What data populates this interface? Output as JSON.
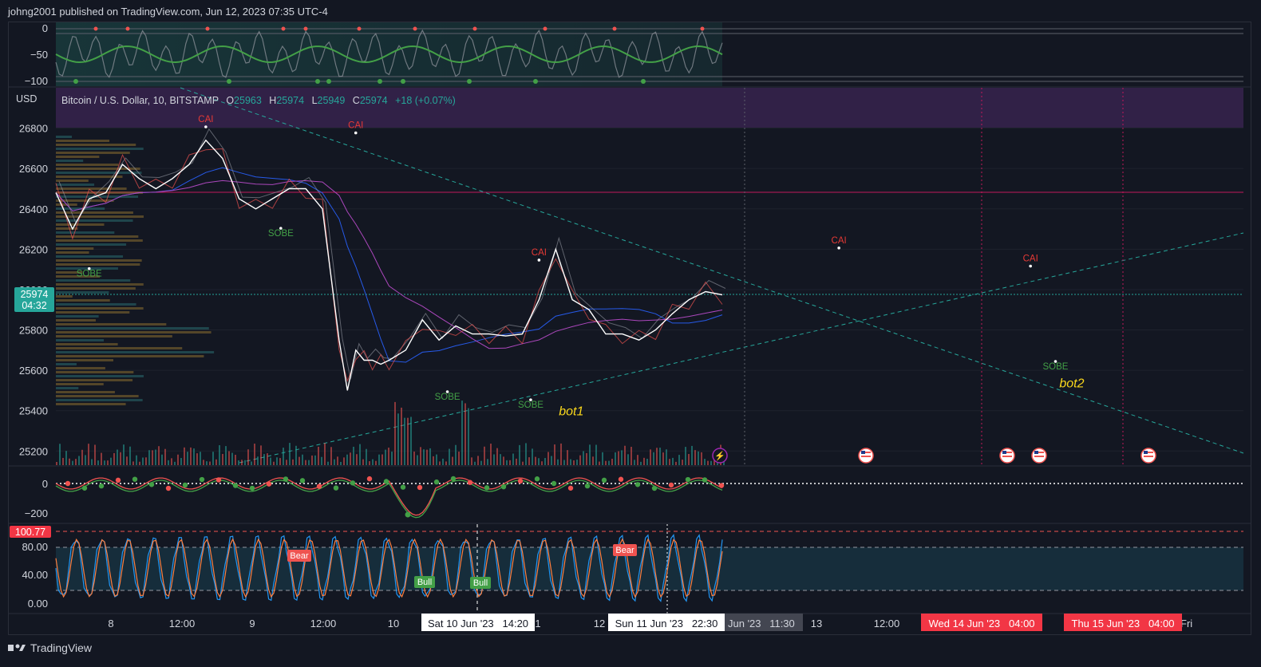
{
  "publisher": "johng2001 published on TradingView.com, Jun 12, 2023 07:35 UTC-4",
  "footer_brand": "TradingView",
  "symbol_line": {
    "name": "Bitcoin / U.S. Dollar, 10, BITSTAMP",
    "o_label": "O",
    "o": "25963",
    "h_label": "H",
    "h": "25974",
    "l_label": "L",
    "l": "25949",
    "c_label": "C",
    "c": "25974",
    "change": "+18 (+0.07%)"
  },
  "currency": "USD",
  "last_price": "25974",
  "countdown": "04:32",
  "colors": {
    "background": "#131722",
    "up": "#26a69a",
    "down": "#ef5350",
    "sell_label": "#e53935",
    "buy_label": "#43a047",
    "annotation": "#f9d71c",
    "stoch_k": "#2196f3",
    "stoch_d": "#ff7f3f",
    "resistance": "#c2185b"
  },
  "annotations": {
    "bot1": "bot1",
    "bot2": "bot2"
  },
  "signal_labels": {
    "sell": "CAI",
    "buy": "SOBE"
  },
  "stoch_labels": {
    "bear1": "Bear",
    "bear2": "Bear",
    "bull1": "Bull",
    "bull2": "Bull"
  },
  "stoch_badge": "100.77",
  "time_labels": {
    "t1": "8",
    "t2": "12:00",
    "t3": "9",
    "t4": "12:00",
    "t5": "10",
    "t6": "1",
    "t7": "12",
    "t8": "Jun '23",
    "t9": "11:30",
    "t10": "13",
    "t11": "12:00",
    "t12": "Fri"
  },
  "time_badges": {
    "cursor1": "Sat 10 Jun '23   14:20",
    "cursor2": "Sun 11 Jun '23   22:30",
    "event1": "Wed 14 Jun '23   04:00",
    "event2": "Thu 15 Jun '23   04:00"
  },
  "chart_data": [
    {
      "panel": "top-oscillator",
      "type": "line",
      "y_ticks": [
        "0",
        "−50",
        "−100"
      ],
      "ylim": [
        -100,
        0
      ]
    },
    {
      "panel": "price",
      "type": "line",
      "title": "Bitcoin / U.S. Dollar, 10, BITSTAMP",
      "ylabel": "USD",
      "ylim": [
        25130,
        27000
      ],
      "y_ticks": [
        "26800",
        "26600",
        "26400",
        "26200",
        "26000",
        "25800",
        "25600",
        "25400",
        "25200"
      ],
      "x_ticks": [
        "8",
        "12:00",
        "9",
        "12:00",
        "10",
        "1",
        "12",
        "Jun '23",
        "11:30",
        "13",
        "12:00",
        "Fri"
      ],
      "resistance_level": 26480,
      "series": [
        {
          "x": [
            0,
            10,
            20,
            30,
            40,
            50,
            60,
            70,
            80,
            90,
            100,
            110,
            120,
            130,
            140,
            150,
            160,
            170,
            175,
            180,
            185,
            190,
            195,
            200,
            210,
            220,
            230,
            240,
            250,
            260,
            270,
            280,
            290,
            300,
            310,
            320,
            330,
            340,
            350,
            360,
            370,
            380,
            390,
            400
          ],
          "y": [
            26480,
            26300,
            26450,
            26480,
            26620,
            26550,
            26500,
            26550,
            26620,
            26740,
            26650,
            26450,
            26400,
            26450,
            26500,
            26500,
            26400,
            25750,
            25500,
            25700,
            25650,
            25650,
            25630,
            25650,
            25700,
            25850,
            25750,
            25820,
            25780,
            25780,
            25770,
            25780,
            25950,
            26200,
            25950,
            25900,
            25780,
            25780,
            25750,
            25800,
            25880,
            25950,
            25990,
            25974
          ]
        }
      ],
      "signals": [
        {
          "label": "CAI",
          "x": 90,
          "y": 26830
        },
        {
          "label": "CAI",
          "x": 180,
          "y": 26800
        },
        {
          "label": "CAI",
          "x": 290,
          "y": 26170
        },
        {
          "label": "CAI",
          "x": 470,
          "y": 26230
        },
        {
          "label": "CAI",
          "x": 585,
          "y": 26140
        },
        {
          "label": "SOBE",
          "x": 20,
          "y": 26080
        },
        {
          "label": "SOBE",
          "x": 135,
          "y": 26280
        },
        {
          "label": "SOBE",
          "x": 235,
          "y": 25470
        },
        {
          "label": "SOBE",
          "x": 285,
          "y": 25430
        },
        {
          "label": "SOBE",
          "x": 600,
          "y": 25620
        }
      ],
      "annotations": [
        {
          "label": "bot1",
          "x": 300,
          "y": 25400
        },
        {
          "label": "bot2",
          "x": 610,
          "y": 25540
        }
      ]
    },
    {
      "panel": "momentum-oscillator",
      "type": "line",
      "y_ticks": [
        "0",
        "−200"
      ],
      "ylim": [
        -280,
        80
      ]
    },
    {
      "panel": "stochastic",
      "type": "line",
      "y_ticks": [
        "80.00",
        "40.00",
        "0.00"
      ],
      "ylim": [
        -5,
        110
      ],
      "overbought": 80,
      "oversold": 20
    }
  ]
}
